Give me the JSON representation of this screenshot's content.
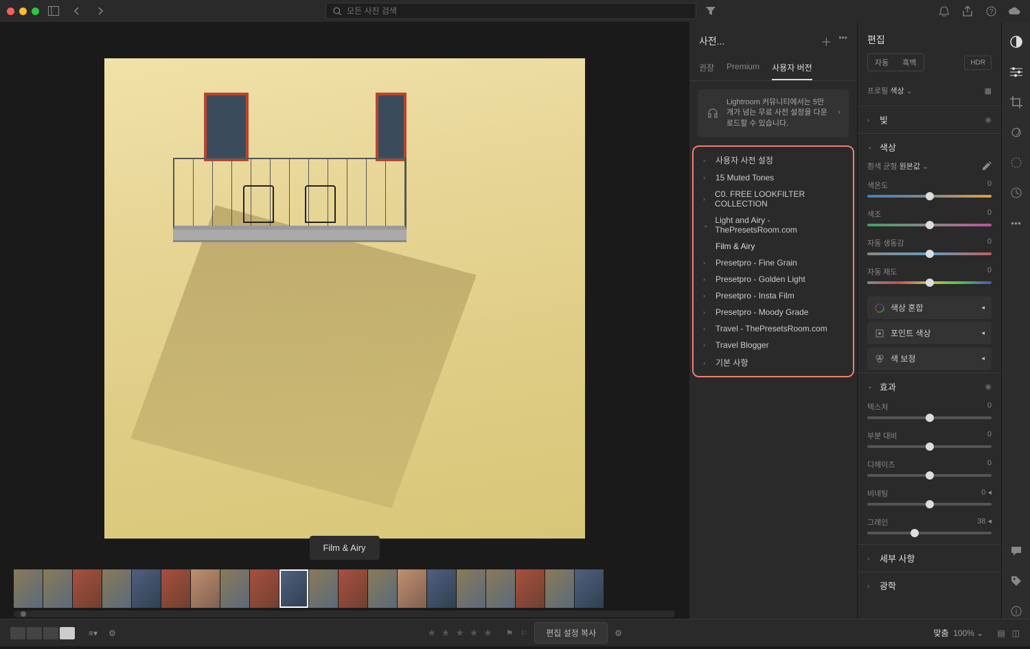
{
  "topbar": {
    "search_placeholder": "모든 사진 검색"
  },
  "canvas": {
    "preset_badge": "Film & Airy"
  },
  "presets": {
    "title": "사전...",
    "tabs": {
      "recommended": "권장",
      "premium": "Premium",
      "user": "사용자 버전"
    },
    "promo": "Lightroom 커뮤니티에서는 5만 개가 넘는 무료 사전 설정을 다운로드할 수 있습니다.",
    "groups": [
      {
        "label": "사용자 사전 설정",
        "expanded": false
      },
      {
        "label": "15 Muted Tones",
        "expanded": false
      },
      {
        "label": "C0. FREE LOOKFILTER COLLECTION",
        "expanded": false
      },
      {
        "label": "Light and Airy - ThePresetsRoom.com",
        "expanded": true
      },
      {
        "label": "Presetpro - Fine Grain",
        "expanded": false
      },
      {
        "label": "Presetpro - Golden Light",
        "expanded": false
      },
      {
        "label": "Presetpro - Insta Film",
        "expanded": false
      },
      {
        "label": "Presetpro - Moody Grade",
        "expanded": false
      },
      {
        "label": "Travel - ThePresetsRoom.com",
        "expanded": false
      },
      {
        "label": "Travel Blogger",
        "expanded": false
      },
      {
        "label": "기본 사항",
        "expanded": false
      }
    ],
    "sub_item": "Film & Airy"
  },
  "edit": {
    "title": "편집",
    "mode_auto": "자동",
    "mode_bw": "흑백",
    "hdr": "HDR",
    "profile_label": "프로필",
    "profile_value": "색상",
    "section_light": "빛",
    "section_color": "색상",
    "wb_label": "흰색 균형",
    "wb_value": "원본값",
    "sliders_color": [
      {
        "name": "색온도",
        "value": "0",
        "track": "temp"
      },
      {
        "name": "색조",
        "value": "0",
        "track": "tint"
      },
      {
        "name": "자동 생동감",
        "value": "0",
        "track": "vib"
      },
      {
        "name": "자동 채도",
        "value": "0",
        "track": "sat"
      }
    ],
    "btn_colormix": "색상 혼합",
    "btn_pointcolor": "포인트 색상",
    "btn_colorgrading": "색 보정",
    "section_effects": "효과",
    "sliders_fx": [
      {
        "name": "텍스처",
        "value": "0"
      },
      {
        "name": "부분 대비",
        "value": "0"
      },
      {
        "name": "디헤이즈",
        "value": "0"
      },
      {
        "name": "비네팅",
        "value": "0"
      },
      {
        "name": "그레인",
        "value": "38"
      }
    ],
    "section_detail": "세부 사항",
    "section_optics": "광학"
  },
  "bottombar": {
    "copy_settings": "편집 설정 복사",
    "fit_label": "맞춤",
    "zoom": "100%"
  }
}
